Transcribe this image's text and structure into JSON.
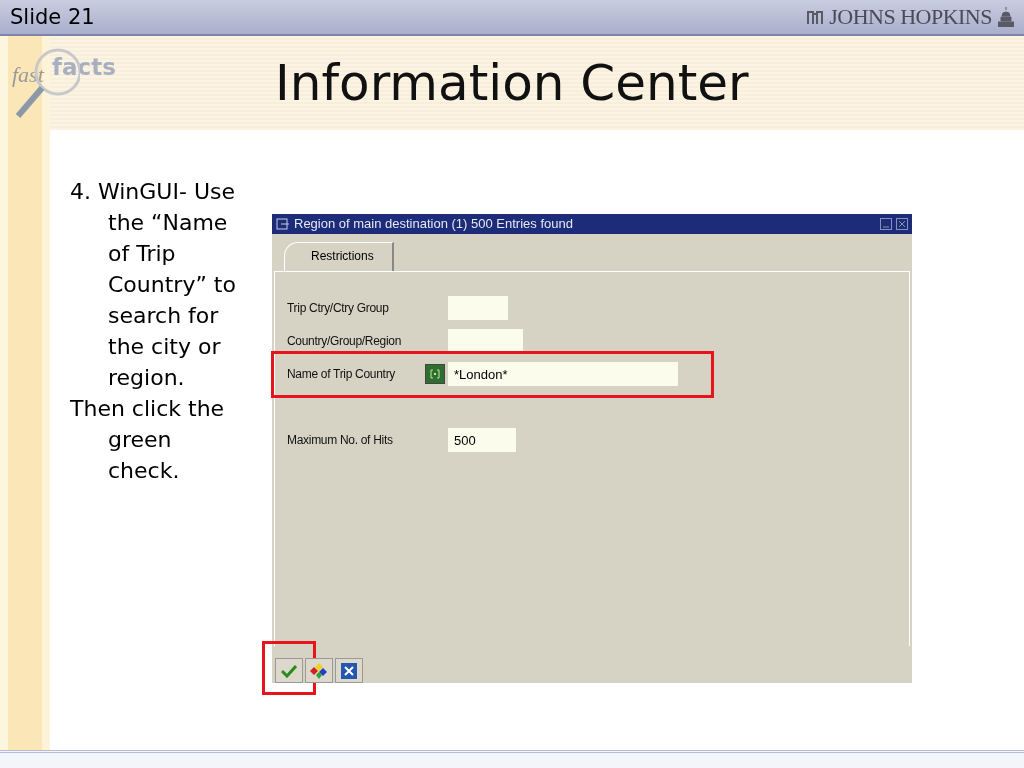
{
  "header": {
    "slide_label": "Slide 21",
    "brand": "JOHNS HOPKINS"
  },
  "logo": {
    "word_1": "fast",
    "word_2": "facts"
  },
  "title": "Information Center",
  "instructions": [
    {
      "text": "4. WinGUI- Use the “Name of Trip Country” to search for the city or region."
    },
    {
      "text": "Then click the green check."
    }
  ],
  "dialog": {
    "title": "Region of main destination (1)  500 Entries found",
    "tabs": [
      {
        "label": "Restrictions",
        "selected": true
      }
    ],
    "fields": [
      {
        "label": "Trip Ctry/Ctry Group",
        "highlighted": false,
        "kind": "plain"
      },
      {
        "label": "Country/Group/Region",
        "highlighted": false,
        "kind": "plain"
      },
      {
        "label": "Name of Trip Country",
        "value": "*London*",
        "highlighted": true,
        "kind": "match"
      },
      {
        "label": "Maximum No. of Hits",
        "value": "500",
        "highlighted": false,
        "kind": "spaced"
      }
    ],
    "footer_buttons": [
      {
        "kind": "confirm",
        "highlighted": true
      },
      {
        "kind": "other",
        "highlighted": false
      },
      {
        "kind": "cancel",
        "highlighted": false
      }
    ]
  }
}
